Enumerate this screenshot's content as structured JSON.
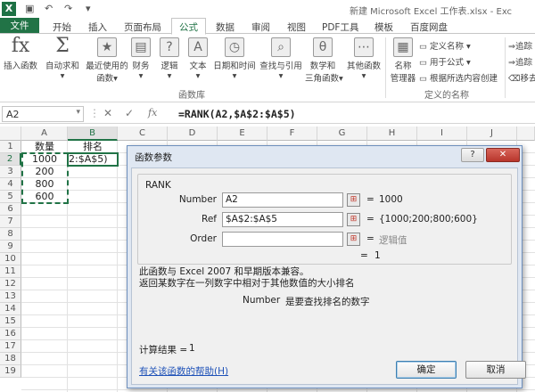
{
  "titlebar": {
    "app_icon": "X",
    "quick_access": [
      "save-icon",
      "undo-icon",
      "redo-icon",
      "customize-icon"
    ],
    "title": "新建 Microsoft Excel 工作表.xlsx - Exc"
  },
  "tabs": {
    "file": "文件",
    "items": [
      "开始",
      "插入",
      "页面布局",
      "公式",
      "数据",
      "审阅",
      "视图",
      "PDF工具",
      "模板",
      "百度网盘"
    ],
    "active": "公式"
  },
  "ribbon": {
    "insert_function": "插入函数",
    "autosum": "自动求和",
    "recently_used": [
      "最近使用的",
      "函数"
    ],
    "financial": "财务",
    "logical": "逻辑",
    "text": "文本",
    "datetime": "日期和时间",
    "lookup": "查找与引用",
    "math": [
      "数学和",
      "三角函数"
    ],
    "other": "其他函数",
    "library_label": "函数库",
    "name_manager": [
      "名称",
      "管理器"
    ],
    "define_name": "定义名称",
    "use_in_formula": "用于公式",
    "create_from_selection": "根据所选内容创建",
    "defined_names_label": "定义的名称",
    "trace_precedents": "追踪",
    "trace_dependents": "追踪",
    "remove_arrows": "移去"
  },
  "formula_bar": {
    "name_box": "A2",
    "cancel": "✕",
    "enter": "✓",
    "fx": "fx",
    "formula": "=RANK(A2,$A$2:$A$5)"
  },
  "sheet": {
    "columns": [
      "A",
      "B",
      "C",
      "D",
      "E",
      "F",
      "G",
      "H",
      "I",
      "J"
    ],
    "rows": [
      "1",
      "2",
      "3",
      "4",
      "5",
      "6",
      "7",
      "8",
      "9",
      "10",
      "11",
      "12",
      "13",
      "14",
      "15",
      "16",
      "17",
      "18",
      "19"
    ],
    "a_header": "数量",
    "b_header": "排名",
    "a_values": [
      "1000",
      "200",
      "800",
      "600"
    ],
    "b2_partial": "2:$A$5)"
  },
  "dialog": {
    "title": "函数参数",
    "help_btn": "?",
    "close_btn": "✕",
    "function_name": "RANK",
    "args": [
      {
        "label": "Number",
        "value": "A2",
        "result": "1000",
        "grey": false
      },
      {
        "label": "Ref",
        "value": "$A$2:$A$5",
        "result": "{1000;200;800;600}",
        "grey": false
      },
      {
        "label": "Order",
        "value": "",
        "result": "逻辑值",
        "grey": true
      }
    ],
    "eq": "=",
    "formula_result": "1",
    "desc_line1": "此函数与 Excel 2007 和早期版本兼容。",
    "desc_line2": "返回某数字在一列数字中相对于其他数值的大小排名",
    "arg_help_name": "Number",
    "arg_help_text": "是要查找排名的数字",
    "calc_label": "计算结果 =",
    "calc_value": "1",
    "help_link": "有关该函数的帮助(H)",
    "ok": "确定",
    "cancel": "取消"
  }
}
